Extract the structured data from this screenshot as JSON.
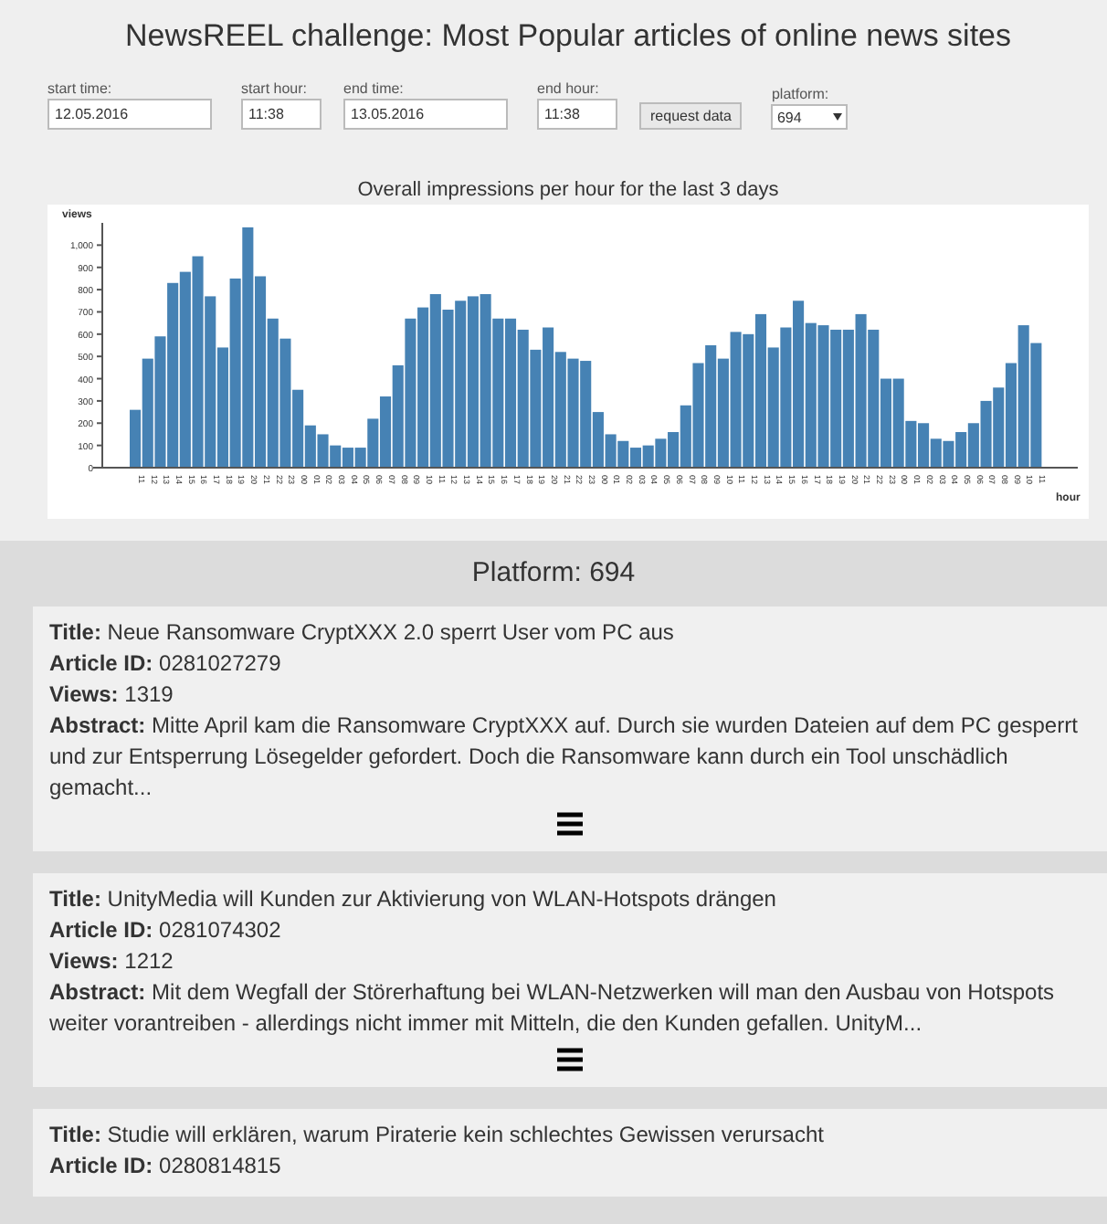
{
  "title": "NewsREEL challenge: Most Popular articles of online news sites",
  "form": {
    "fields": [
      {
        "label": "start time:",
        "value": "12.05.2016",
        "kind": "wide"
      },
      {
        "label": "start hour:",
        "value": "11:38",
        "kind": "narrow"
      },
      {
        "label": "end time:",
        "value": "13.05.2016",
        "kind": "wide"
      },
      {
        "label": "end hour:",
        "value": "11:38",
        "kind": "narrow"
      }
    ],
    "button": "request data",
    "platform": {
      "label": "platform:",
      "value": "694"
    }
  },
  "chart": {
    "title": "Overall impressions per hour for the last 3 days",
    "chart_data": {
      "type": "bar",
      "xlabel": "hour",
      "ylabel": "views",
      "categories": [
        "11",
        "12",
        "13",
        "14",
        "15",
        "16",
        "17",
        "18",
        "19",
        "20",
        "21",
        "22",
        "23",
        "00",
        "01",
        "02",
        "03",
        "04",
        "05",
        "06",
        "07",
        "08",
        "09",
        "10",
        "11",
        "12",
        "13",
        "14",
        "15",
        "16",
        "17",
        "18",
        "19",
        "20",
        "21",
        "22",
        "23",
        "00",
        "01",
        "02",
        "03",
        "04",
        "05",
        "06",
        "07",
        "08",
        "09",
        "10",
        "11",
        "12",
        "13",
        "14",
        "15",
        "16",
        "17",
        "18",
        "19",
        "20",
        "21",
        "22",
        "23",
        "00",
        "01",
        "02",
        "03",
        "04",
        "05",
        "06",
        "07",
        "08",
        "09",
        "10",
        "11"
      ],
      "values": [
        260,
        490,
        590,
        830,
        880,
        950,
        770,
        540,
        850,
        1080,
        860,
        670,
        580,
        350,
        190,
        150,
        100,
        90,
        90,
        220,
        320,
        460,
        670,
        720,
        780,
        710,
        750,
        770,
        780,
        670,
        670,
        620,
        530,
        630,
        520,
        490,
        480,
        250,
        150,
        120,
        90,
        100,
        130,
        160,
        280,
        470,
        550,
        490,
        610,
        600,
        690,
        540,
        630,
        750,
        650,
        640,
        620,
        620,
        690,
        620,
        400,
        400,
        210,
        200,
        130,
        120,
        160,
        200,
        300,
        360,
        470,
        640,
        560
      ],
      "ylim": [
        0,
        1100
      ],
      "yticks": [
        0,
        100,
        200,
        300,
        400,
        500,
        600,
        700,
        800,
        900,
        {
          "value": 1000,
          "label": "1,000"
        }
      ]
    }
  },
  "platform_heading": "Platform: 694",
  "articles": [
    {
      "fields": [
        {
          "label": "Title:",
          "value": "Neue Ransomware CryptXXX 2.0 sperrt User vom PC aus"
        },
        {
          "label": "Article ID:",
          "value": "0281027279"
        },
        {
          "label": "Views:",
          "value": "1319"
        },
        {
          "label": "Abstract:",
          "value": "Mitte April kam die Ransomware CryptXXX auf. Durch sie wurden Dateien auf dem PC gesperrt und zur Entsperrung Lösegelder gefordert. Doch die Ransomware kann durch ein Tool unschädlich gemacht..."
        }
      ],
      "menu": true
    },
    {
      "fields": [
        {
          "label": "Title:",
          "value": "UnityMedia will Kunden zur Aktivierung von WLAN-Hotspots drängen"
        },
        {
          "label": "Article ID:",
          "value": "0281074302"
        },
        {
          "label": "Views:",
          "value": "1212"
        },
        {
          "label": "Abstract:",
          "value": "Mit dem Wegfall der Störerhaftung bei WLAN-Netzwerken will man den Ausbau von Hotspots weiter vorantreiben - allerdings nicht immer mit Mitteln, die den Kunden gefallen. UnityM..."
        }
      ],
      "menu": true
    },
    {
      "fields": [
        {
          "label": "Title:",
          "value": "Studie will erklären, warum Piraterie kein schlechtes Gewissen verursacht"
        },
        {
          "label": "Article ID:",
          "value": "0280814815"
        }
      ],
      "menu": false
    }
  ]
}
